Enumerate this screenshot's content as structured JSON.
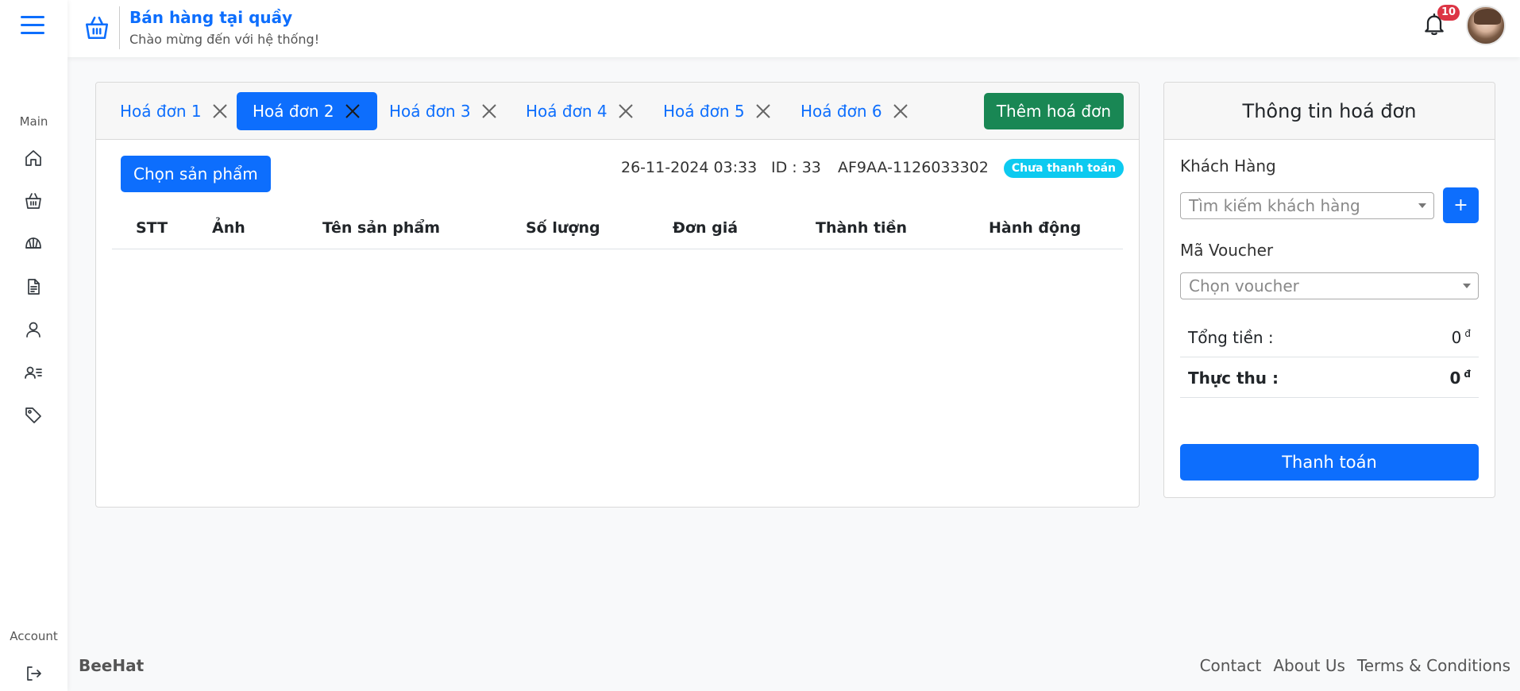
{
  "sidebar": {
    "main_label": "Main",
    "account_label": "Account",
    "items": [
      {
        "icon": "home-icon"
      },
      {
        "icon": "basket-icon"
      },
      {
        "icon": "cap-icon"
      },
      {
        "icon": "document-icon"
      },
      {
        "icon": "user-icon"
      },
      {
        "icon": "user-list-icon"
      },
      {
        "icon": "tag-icon"
      }
    ],
    "logout_icon": "logout-icon"
  },
  "header": {
    "title": "Bán hàng tại quầy",
    "subtitle": "Chào mừng đến với hệ thống!",
    "notification_count": "10"
  },
  "invoice": {
    "tabs": [
      {
        "label": "Hoá đơn 1",
        "active": false
      },
      {
        "label": "Hoá đơn 2",
        "active": true
      },
      {
        "label": "Hoá đơn 3",
        "active": false
      },
      {
        "label": "Hoá đơn 4",
        "active": false
      },
      {
        "label": "Hoá đơn 5",
        "active": false
      },
      {
        "label": "Hoá đơn 6",
        "active": false
      }
    ],
    "add_button": "Thêm hoá đơn",
    "choose_product_button": "Chọn sản phẩm",
    "datetime": "26-11-2024 03:33",
    "id_text": "ID : 33",
    "code": "AF9AA-1126033302",
    "status": "Chưa thanh toán",
    "columns": [
      "STT",
      "Ảnh",
      "Tên sản phẩm",
      "Số lượng",
      "Đơn giá",
      "Thành tiền",
      "Hành động"
    ],
    "rows": []
  },
  "info_panel": {
    "title": "Thông tin hoá đơn",
    "customer_label": "Khách Hàng",
    "customer_placeholder": "Tìm kiếm khách hàng",
    "add_customer_button": "+",
    "voucher_label": "Mã Voucher",
    "voucher_placeholder": "Chọn voucher",
    "total_label": "Tổng tiền :",
    "total_value": "0",
    "received_label": "Thực thu :",
    "received_value": "0",
    "currency": "đ",
    "pay_button": "Thanh toán"
  },
  "footer": {
    "brand": "BeeHat",
    "links": [
      "Contact",
      "About Us",
      "Terms & Conditions"
    ]
  },
  "colors": {
    "primary": "#0d6efd",
    "success": "#198754",
    "info": "#0dcaf0",
    "danger": "#dc3545"
  }
}
